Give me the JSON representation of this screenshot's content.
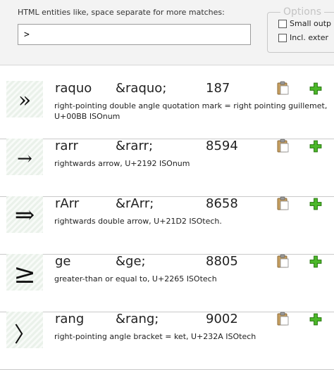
{
  "search": {
    "label": "HTML entities like, space separate for more matches:",
    "value": ">"
  },
  "options": {
    "legend": "Options",
    "items": [
      {
        "label": "Small outp",
        "checked": false
      },
      {
        "label": "Incl. exter",
        "checked": false
      }
    ]
  },
  "results": [
    {
      "glyph": "»",
      "name": "raquo",
      "code": "&raquo;",
      "number": "187",
      "description": "right-pointing double angle quotation mark = right pointing guillemet, U+00BB ISOnum"
    },
    {
      "glyph": "→",
      "name": "rarr",
      "code": "&rarr;",
      "number": "8594",
      "description": "rightwards arrow, U+2192 ISOnum"
    },
    {
      "glyph": "⇒",
      "name": "rArr",
      "code": "&rArr;",
      "number": "8658",
      "description": "rightwards double arrow, U+21D2 ISOtech."
    },
    {
      "glyph": "≥",
      "name": "ge",
      "code": "&ge;",
      "number": "8805",
      "description": "greater-than or equal to, U+2265 ISOtech"
    },
    {
      "glyph": "〉",
      "name": "rang",
      "code": "&rang;",
      "number": "9002",
      "description": "right-pointing angle bracket = ket, U+232A ISOtech"
    }
  ],
  "icons": {
    "copy": "clipboard-icon",
    "add": "plus-icon"
  },
  "colors": {
    "add_green": "#3a9a1a",
    "clipboard_board": "#c8a060",
    "panel_bg": "#f3f3f3"
  }
}
